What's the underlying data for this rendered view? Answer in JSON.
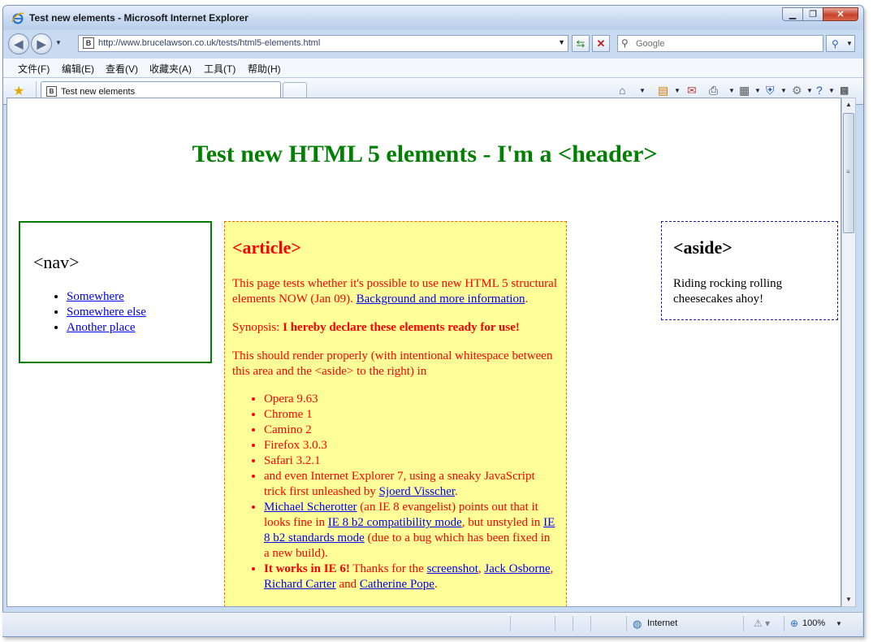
{
  "window": {
    "title": "Test new elements - Microsoft Internet Explorer"
  },
  "address": {
    "url": "http://www.brucelawson.co.uk/tests/html5-elements.html",
    "favicon_text": "B"
  },
  "search": {
    "placeholder": "Google"
  },
  "menu": [
    "文件(F)",
    "编辑(E)",
    "查看(V)",
    "收藏夹(A)",
    "工具(T)",
    "帮助(H)"
  ],
  "tab": {
    "label": "Test new elements"
  },
  "page": {
    "header": "Test new HTML 5 elements - I'm a <header>",
    "nav": {
      "heading": "<nav>",
      "links": [
        "Somewhere",
        "Somewhere else",
        "Another place"
      ]
    },
    "article": {
      "heading": "<article>",
      "p1_text": "This page tests whether it's possible to use new HTML 5 structural elements NOW (Jan 09). ",
      "p1_link": "Background and more information",
      "p1_end": ".",
      "synopsis_label": "Synopsis: ",
      "synopsis_bold": "I hereby declare these elements ready for use!",
      "p3": "This should render properly (with intentional whitespace between this area and the <aside> to the right) in",
      "browsers": [
        "Opera 9.63",
        "Chrome 1",
        "Camino 2",
        "Firefox 3.0.3",
        "Safari 3.2.1"
      ],
      "ie7_text": "and even Internet Explorer 7, using a sneaky JavaScript trick first unleashed by ",
      "ie7_link": "Sjoerd Visscher",
      "ms_link": "Michael Scherotter",
      "ms_text1": " (an IE 8 evangelist) points out that it looks fine in ",
      "ms_link2": "IE 8 b2 compatibility mode",
      "ms_text2": ", but unstyled in ",
      "ms_link3": "IE 8 b2 standards mode",
      "ms_text3": " (due to a bug which has been fixed in a new build).",
      "ie6_bold": "It works in IE 6!",
      "ie6_text": " Thanks for the ",
      "ie6_link1": "screenshot",
      "ie6_link2": "Jack Osborne",
      "ie6_link3": "Richard Carter",
      "ie6_and": " and ",
      "ie6_link4": "Catherine Pope"
    },
    "aside": {
      "heading": "<aside>",
      "text": "Riding rocking rolling cheesecakes ahoy!"
    }
  },
  "status": {
    "zone": "Internet",
    "zoom": "100%"
  },
  "colors": {
    "header": "#008000",
    "article_text": "#ff0000",
    "article_bg": "#ffff99",
    "link": "#0000ee"
  }
}
